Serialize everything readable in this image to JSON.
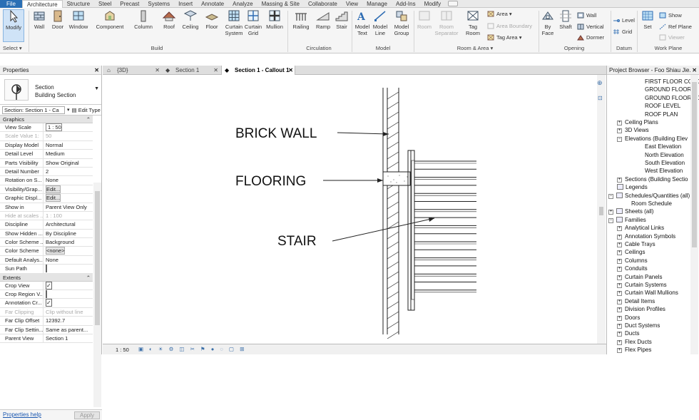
{
  "ribbon_tabs": [
    "File",
    "Architecture",
    "Structure",
    "Steel",
    "Precast",
    "Systems",
    "Insert",
    "Annotate",
    "Analyze",
    "Massing & Site",
    "Collaborate",
    "View",
    "Manage",
    "Add-Ins",
    "Modify"
  ],
  "active_tab": "Architecture",
  "ribbon": {
    "select": {
      "modify": "Modify",
      "select_label": "Select ▾"
    },
    "build": {
      "wall": "Wall",
      "door": "Door",
      "window": "Window",
      "component": "Component",
      "column": "Column",
      "roof": "Roof",
      "ceiling": "Ceiling",
      "floor": "Floor",
      "curtain_system": "Curtain\nSystem",
      "curtain_grid": "Curtain\nGrid",
      "mullion": "Mullion",
      "panel": "Build"
    },
    "circulation": {
      "railing": "Railing",
      "ramp": "Ramp",
      "stair": "Stair",
      "panel": "Circulation"
    },
    "model": {
      "model_text": "Model\nText",
      "model_line": "Model\nLine",
      "model_group": "Model\nGroup",
      "panel": "Model"
    },
    "room_area": {
      "room": "Room",
      "room_separator": "Room\nSeparator",
      "tag_room": "Tag\nRoom",
      "area": "Area ▾",
      "area_boundary": "Area  Boundary",
      "tag_area": "Tag  Area ▾",
      "panel": "Room & Area ▾"
    },
    "opening": {
      "by_face": "By\nFace",
      "shaft": "Shaft",
      "wall": "Wall",
      "vertical": "Vertical",
      "dormer": "Dormer",
      "panel": "Opening"
    },
    "datum": {
      "level": "Level",
      "grid": "Grid",
      "panel": "Datum"
    },
    "work_plane": {
      "set": "Set",
      "show": "Show",
      "ref_plane": "Ref  Plane",
      "viewer": "Viewer",
      "panel": "Work Plane"
    }
  },
  "properties": {
    "title": "Properties",
    "type_name": "Section",
    "type_sub": "Building Section",
    "selector": "Section: Section 1 - Ca",
    "edit_type": "Edit Type",
    "groups": [
      {
        "name": "Graphics",
        "rows": [
          {
            "k": "View Scale",
            "v": "1 : 50",
            "kind": "box"
          },
          {
            "k": "Scale Value    1:",
            "v": "50",
            "kind": "dis"
          },
          {
            "k": "Display Model",
            "v": "Normal"
          },
          {
            "k": "Detail Level",
            "v": "Medium"
          },
          {
            "k": "Parts Visibility",
            "v": "Show Original"
          },
          {
            "k": "Detail Number",
            "v": "2"
          },
          {
            "k": "Rotation on S...",
            "v": "None"
          },
          {
            "k": "Visibility/Grap...",
            "v": "Edit...",
            "kind": "btn"
          },
          {
            "k": "Graphic Displ...",
            "v": "Edit...",
            "kind": "btn"
          },
          {
            "k": "Show in",
            "v": "Parent View Only"
          },
          {
            "k": "Hide at scales ...",
            "v": "1 : 100",
            "kind": "dis"
          },
          {
            "k": "Discipline",
            "v": "Architectural"
          },
          {
            "k": "Show Hidden ...",
            "v": "By Discipline"
          },
          {
            "k": "Color Scheme ...",
            "v": "Background"
          },
          {
            "k": "Color Scheme",
            "v": "<none>",
            "kind": "btn"
          },
          {
            "k": "Default Analys...",
            "v": "None"
          },
          {
            "k": "Sun Path",
            "v": "",
            "kind": "chk"
          }
        ]
      },
      {
        "name": "Extents",
        "rows": [
          {
            "k": "Crop View",
            "v": "✓",
            "kind": "chk"
          },
          {
            "k": "Crop Region V...",
            "v": "",
            "kind": "chk"
          },
          {
            "k": "Annotation Cr...",
            "v": "✓",
            "kind": "chk"
          },
          {
            "k": "Far Clipping",
            "v": "Clip without line",
            "kind": "dis"
          },
          {
            "k": "Far Clip Offset",
            "v": "12392.7"
          },
          {
            "k": "Far Clip Settin...",
            "v": "Same as parent..."
          },
          {
            "k": "Parent View",
            "v": "Section 1"
          }
        ]
      }
    ],
    "help_link": "Properties help",
    "apply": "Apply"
  },
  "view_tabs": [
    {
      "label": "{3D}",
      "active": false
    },
    {
      "label": "Section 1",
      "active": false
    },
    {
      "label": "Section 1 - Callout 1",
      "active": true
    }
  ],
  "drawing_labels": {
    "brick_wall": "BRICK WALL",
    "flooring": "FLOORING",
    "stair": "STAIR"
  },
  "view_control": {
    "scale": "1 : 50"
  },
  "browser": {
    "title": "Project Browser - Foo Shiau Jie...",
    "items": [
      {
        "t": "FIRST FLOOR COLOU",
        "lvl": 4,
        "exp": ""
      },
      {
        "t": "GROUND FLOOR",
        "lvl": 4,
        "exp": ""
      },
      {
        "t": "GROUND FLOOR COL",
        "lvl": 4,
        "exp": ""
      },
      {
        "t": "ROOF LEVEL",
        "lvl": 4,
        "exp": ""
      },
      {
        "t": "ROOF PLAN",
        "lvl": 4,
        "exp": ""
      },
      {
        "t": "Ceiling Plans",
        "lvl": 2,
        "exp": "+"
      },
      {
        "t": "3D Views",
        "lvl": 2,
        "exp": "+"
      },
      {
        "t": "Elevations (Building Elev",
        "lvl": 2,
        "exp": "−"
      },
      {
        "t": "East Elevation",
        "lvl": 4,
        "exp": ""
      },
      {
        "t": "North Elevation",
        "lvl": 4,
        "exp": ""
      },
      {
        "t": "South Elevation",
        "lvl": 4,
        "exp": ""
      },
      {
        "t": "West Elevation",
        "lvl": 4,
        "exp": ""
      },
      {
        "t": "Sections (Building Sectio",
        "lvl": 2,
        "exp": "+"
      },
      {
        "t": "Legends",
        "lvl": 1,
        "exp": "",
        "ico": true
      },
      {
        "t": "Schedules/Quantities (all)",
        "lvl": 1,
        "exp": "−",
        "ico": true
      },
      {
        "t": "Room Schedule",
        "lvl": 3,
        "exp": ""
      },
      {
        "t": "Sheets (all)",
        "lvl": 1,
        "exp": "+",
        "ico": true
      },
      {
        "t": "Families",
        "lvl": 1,
        "exp": "−",
        "ico": true
      },
      {
        "t": "Analytical Links",
        "lvl": 2,
        "exp": "+"
      },
      {
        "t": "Annotation Symbols",
        "lvl": 2,
        "exp": "+"
      },
      {
        "t": "Cable Trays",
        "lvl": 2,
        "exp": "+"
      },
      {
        "t": "Ceilings",
        "lvl": 2,
        "exp": "+"
      },
      {
        "t": "Columns",
        "lvl": 2,
        "exp": "+"
      },
      {
        "t": "Conduits",
        "lvl": 2,
        "exp": "+"
      },
      {
        "t": "Curtain Panels",
        "lvl": 2,
        "exp": "+"
      },
      {
        "t": "Curtain Systems",
        "lvl": 2,
        "exp": "+"
      },
      {
        "t": "Curtain Wall Mullions",
        "lvl": 2,
        "exp": "+"
      },
      {
        "t": "Detail Items",
        "lvl": 2,
        "exp": "+"
      },
      {
        "t": "Division Profiles",
        "lvl": 2,
        "exp": "+"
      },
      {
        "t": "Doors",
        "lvl": 2,
        "exp": "+"
      },
      {
        "t": "Duct Systems",
        "lvl": 2,
        "exp": "+"
      },
      {
        "t": "Ducts",
        "lvl": 2,
        "exp": "+"
      },
      {
        "t": "Flex Ducts",
        "lvl": 2,
        "exp": "+"
      },
      {
        "t": "Flex Pipes",
        "lvl": 2,
        "exp": "+"
      }
    ]
  },
  "colors": {
    "file_tab": "#2a6fb5",
    "selected": "#cfe3f7",
    "accent_icon": "#2f6db3"
  }
}
